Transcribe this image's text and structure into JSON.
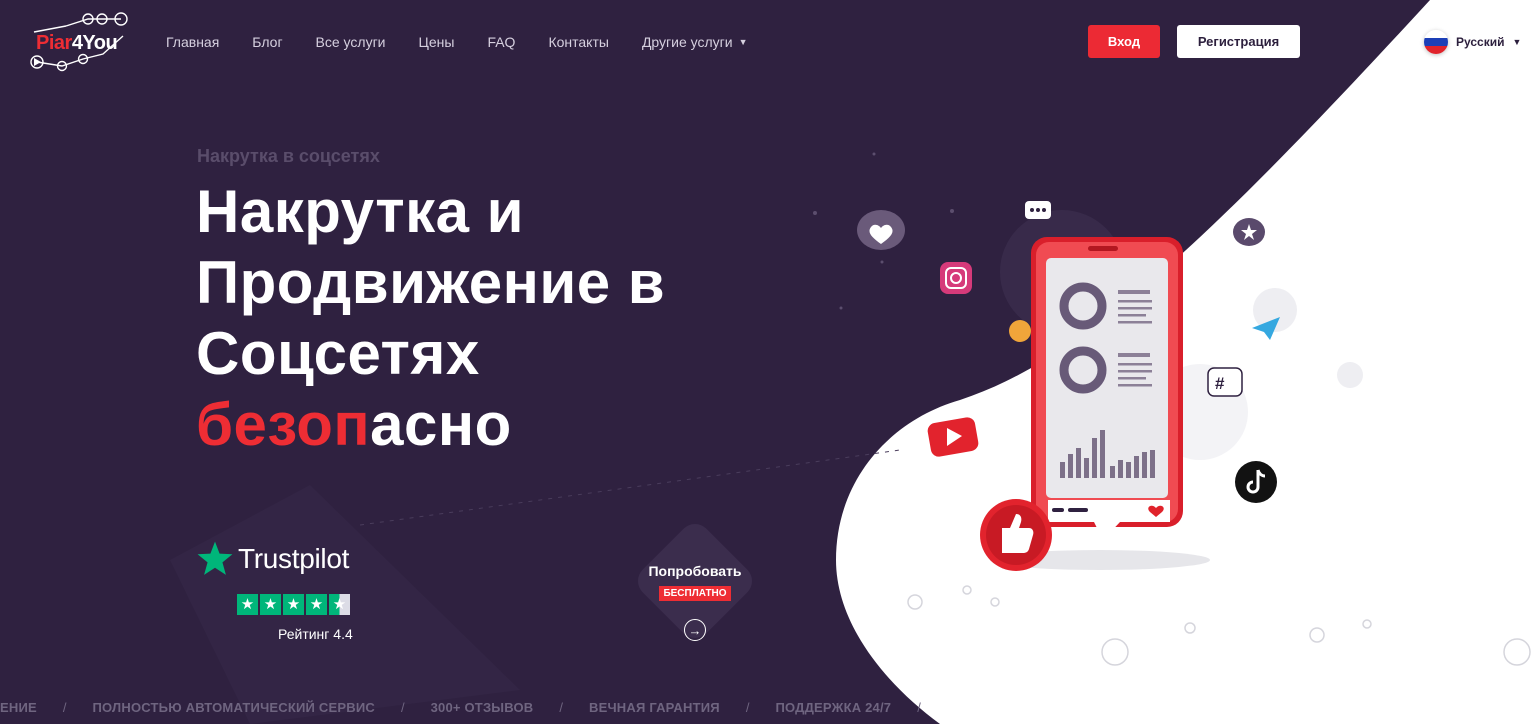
{
  "brand": {
    "logo_part1": "Piar",
    "logo_part2": "4You",
    "red": "#ee2d34",
    "dark": "#2f2140"
  },
  "nav": {
    "items": [
      {
        "label": "Главная"
      },
      {
        "label": "Блог"
      },
      {
        "label": "Все услуги"
      },
      {
        "label": "Цены"
      },
      {
        "label": "FAQ"
      },
      {
        "label": "Контакты"
      },
      {
        "label": "Другие услуги",
        "has_dropdown": true
      }
    ],
    "login_label": "Вход",
    "register_label": "Регистрация",
    "language": "Русский"
  },
  "hero": {
    "eyebrow": "Накрутка в соцсетях",
    "headline_line1": "Накрутка и",
    "headline_line2": "Продвижение в",
    "headline_line3": "Соцсетях",
    "headline_red": "безоп",
    "headline_white": "асно"
  },
  "trustpilot": {
    "label": "Trustpilot",
    "stars": 4.5,
    "rating_text": "Рейтинг 4.4"
  },
  "try": {
    "title": "Попробовать",
    "badge": "БЕСПЛАТНО"
  },
  "ticker": {
    "items": [
      "ЕНИЕ",
      "ПОЛНОСТЬЮ АВТОМАТИЧЕСКИЙ СЕРВИС",
      "300+ ОТЗЫВОВ",
      "ВЕЧНАЯ ГАРАНТИЯ",
      "ПОДДЕРЖКА 24/7"
    ],
    "separator": "/"
  },
  "icons": {
    "star": "star-icon",
    "arrow": "arrow-right-icon",
    "caret": "chevron-down-icon",
    "phone": "smartphone-illustration",
    "instagram": "instagram-icon",
    "youtube": "youtube-icon",
    "tiktok": "tiktok-icon",
    "telegram": "telegram-icon",
    "like": "thumbs-up-icon",
    "heart": "heart-icon"
  }
}
